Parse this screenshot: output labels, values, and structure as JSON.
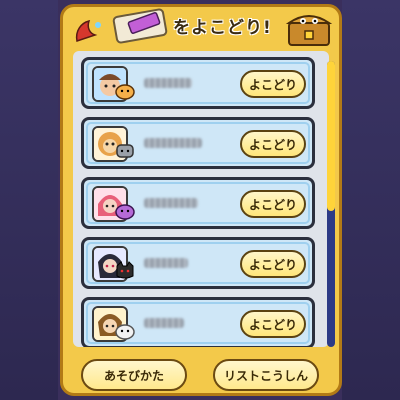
{
  "header": {
    "title": "をよこどり!"
  },
  "rows": [
    {
      "button_label": "よこどり",
      "avatar": "boy-with-cap-avatar",
      "badge": "orange-yokai-badge"
    },
    {
      "button_label": "よこどり",
      "avatar": "lion-yokai-avatar",
      "badge": "grey-yokai-badge"
    },
    {
      "button_label": "よこどり",
      "avatar": "pink-haired-yokai-avatar",
      "badge": "purple-yokai-badge"
    },
    {
      "button_label": "よこどり",
      "avatar": "dark-haired-yokai-avatar",
      "badge": "black-cat-yokai-badge"
    },
    {
      "button_label": "よこどり",
      "avatar": "brown-haired-avatar",
      "badge": "white-yokai-badge"
    }
  ],
  "footer": {
    "how_to_play_label": "あそびかた",
    "refresh_list_label": "リストこうしん"
  },
  "colors": {
    "frame": "#f3c94a",
    "row_bg": "#cfe7f7",
    "button_bg": "#ffe67a",
    "scrollbar_track": "#2c3a86",
    "scrollbar_thumb": "#ffd43a"
  }
}
